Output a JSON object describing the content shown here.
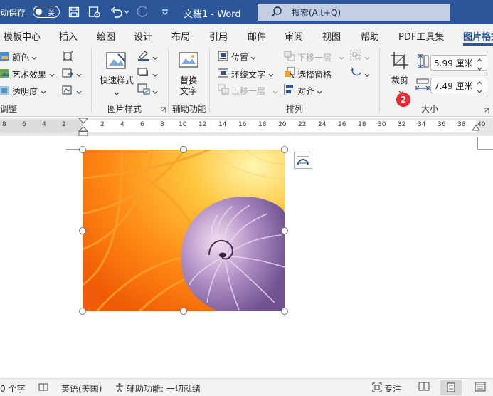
{
  "titlebar": {
    "autosave_label": "自动保存",
    "toggle_state": "关",
    "doc_title": "文档1 - Word",
    "search_text": "搜索(Alt+Q)",
    "bg_color": "#2b579a"
  },
  "tabs": [
    {
      "label": "模板中心"
    },
    {
      "label": "插入"
    },
    {
      "label": "绘图"
    },
    {
      "label": "设计"
    },
    {
      "label": "布局"
    },
    {
      "label": "引用"
    },
    {
      "label": "邮件"
    },
    {
      "label": "审阅"
    },
    {
      "label": "视图"
    },
    {
      "label": "帮助"
    },
    {
      "label": "PDF工具集"
    },
    {
      "label": "图片格式"
    }
  ],
  "ribbon": {
    "adjust": {
      "color_label": "颜色",
      "art_effects_label": "艺术效果",
      "transparency_label": "透明度",
      "group_label": "调整"
    },
    "picture_styles": {
      "quick_styles_label": "快速样式",
      "group_label": "图片样式"
    },
    "accessibility": {
      "alt_text_line1": "替换",
      "alt_text_line2": "文字",
      "group_label": "辅助功能"
    },
    "arrange": {
      "position_label": "位置",
      "wrap_text_label": "环绕文字",
      "bring_forward_label": "上移一层",
      "send_backward_label": "下移一层",
      "selection_pane_label": "选择窗格",
      "align_label": "对齐",
      "group_label": "排列"
    },
    "size": {
      "crop_label": "裁剪",
      "height_value": "5.99 厘米",
      "width_value": "7.49 厘米",
      "group_label": "大小",
      "badge_number": "2"
    }
  },
  "ruler": {
    "numbers": [
      "8",
      "6",
      "4",
      "2",
      "2",
      "4",
      "6",
      "8",
      "10",
      "12",
      "14",
      "16",
      "18",
      "20",
      "22",
      "24",
      "26",
      "28",
      "30",
      "32",
      "34",
      "36",
      "38",
      "40"
    ]
  },
  "statusbar": {
    "word_count": "0 个字",
    "language": "英语(美国)",
    "accessibility": "辅助功能: 一切就绪",
    "focus": "专注"
  },
  "colors": {
    "accent": "#2b579a",
    "badge": "#e8292e"
  }
}
